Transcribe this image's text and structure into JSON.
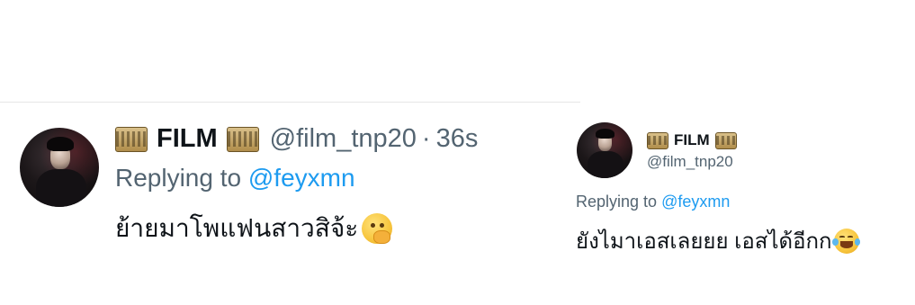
{
  "left_tweet": {
    "display_name": "FILM",
    "handle": "@film_tnp20",
    "separator": "·",
    "timestamp": "36s",
    "replying_prefix": "Replying to ",
    "replying_mention": "@feyxmn",
    "text": "ย้ายมาโพแฟนสาวสิจ้ะ",
    "emoji": "face-with-hand-over-mouth-icon"
  },
  "right_tweet": {
    "display_name": "FILM",
    "handle": "@film_tnp20",
    "replying_prefix": "Replying to ",
    "replying_mention": "@feyxmn",
    "text": "ยังไมาเอสเลยยย เอสได้อีกก",
    "emoji": "face-with-tears-of-joy-icon"
  },
  "colors": {
    "text_primary": "#0f1419",
    "text_secondary": "#536471",
    "mention_blue": "#1d9bf0",
    "divider": "#e6e6e6"
  }
}
